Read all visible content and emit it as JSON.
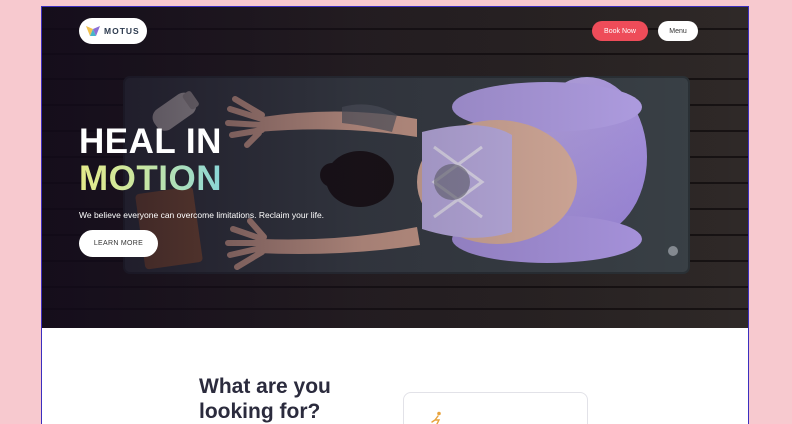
{
  "header": {
    "logo_text": "MOTUS",
    "book_label": "Book Now",
    "menu_label": "Menu"
  },
  "hero": {
    "title_line1": "HEAL IN",
    "title_line2": "MOTION",
    "subtitle": "We believe everyone can overcome limitations. Reclaim your life.",
    "cta_label": "LEARN MORE"
  },
  "section": {
    "title_line1": "What are you",
    "title_line2": "looking for?"
  },
  "colors": {
    "accent": "#ee4c59",
    "heading": "#2b2b3d",
    "page_background": "#f7c9cf"
  },
  "icons": [
    "motus-logo-icon",
    "stretching-person-icon"
  ]
}
